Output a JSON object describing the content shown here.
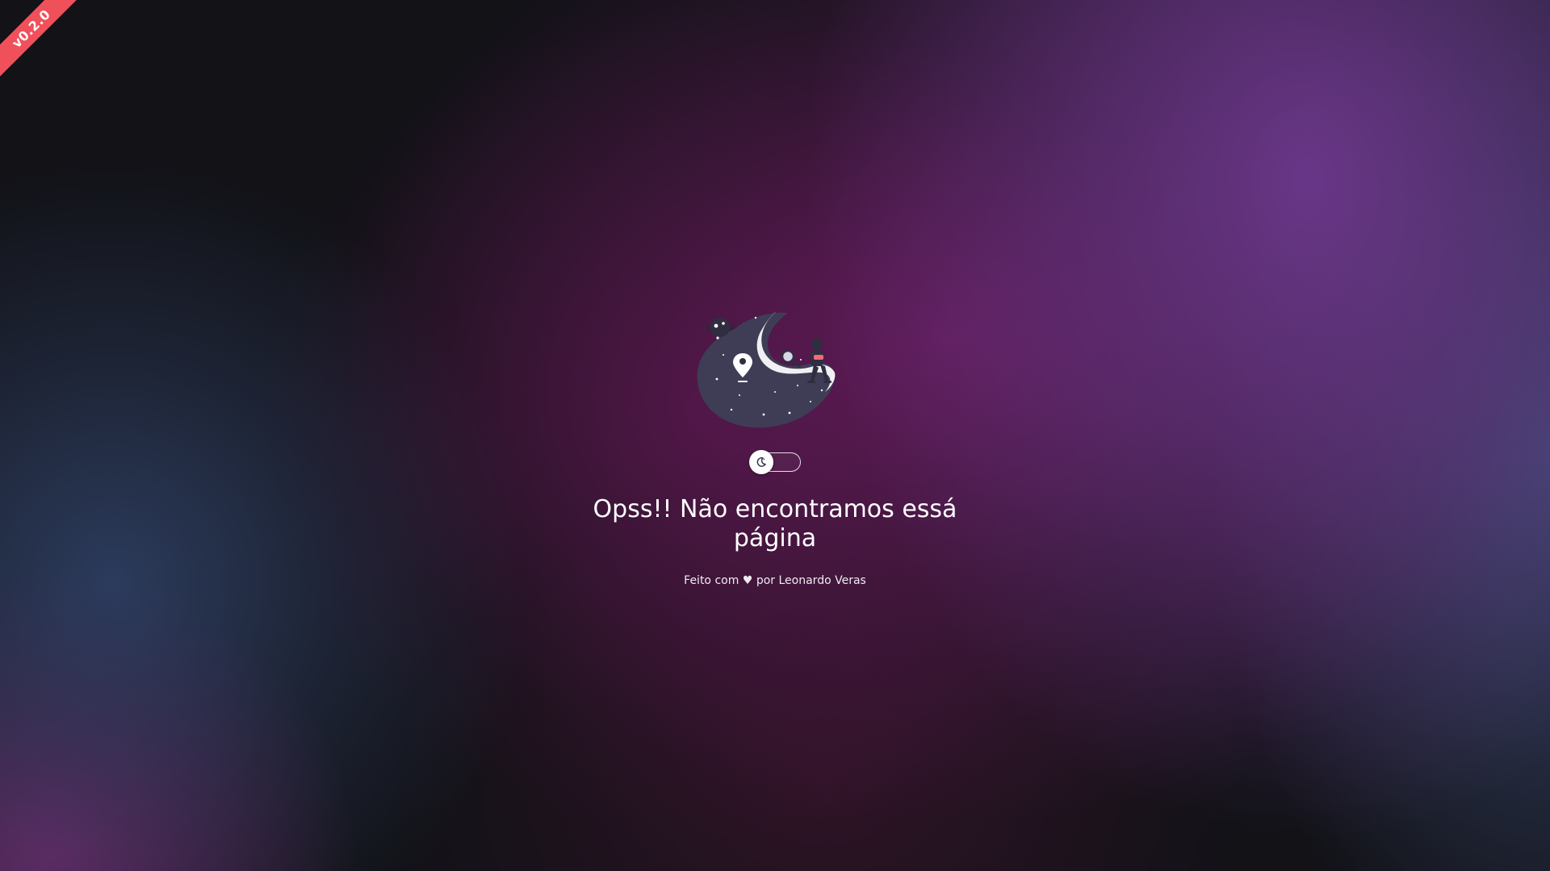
{
  "ribbon": {
    "version": "v0.2.0",
    "color": "#f0505a"
  },
  "illustration": {
    "icon": "lost-astronaut-illustration",
    "blob_color": "#3f3d56"
  },
  "theme_toggle": {
    "icon": "moon-icon",
    "state": "off"
  },
  "error": {
    "title": "Opss!! Não encontramos essá página"
  },
  "footer": {
    "made_with": "Feito com",
    "heart": "♥",
    "by": "por",
    "author": "Leonardo Veras"
  },
  "colors": {
    "background_base": "#121217",
    "accent_purple": "#6c388c",
    "text": "#ffffff"
  }
}
